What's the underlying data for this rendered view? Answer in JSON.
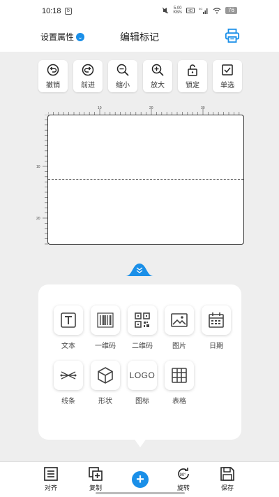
{
  "status_bar": {
    "time": "10:18",
    "speed_value": "5.00",
    "speed_unit": "KB/s",
    "battery": "76"
  },
  "header": {
    "set_attr_label": "设置属性",
    "title": "编辑标记"
  },
  "toolbar": [
    {
      "label": "撤销",
      "icon": "undo-icon"
    },
    {
      "label": "前进",
      "icon": "redo-icon"
    },
    {
      "label": "缩小",
      "icon": "zoom-out-icon"
    },
    {
      "label": "放大",
      "icon": "zoom-in-icon"
    },
    {
      "label": "锁定",
      "icon": "lock-icon"
    },
    {
      "label": "单选",
      "icon": "checkbox-icon"
    }
  ],
  "ruler": {
    "top_labels": [
      "10",
      "20",
      "30"
    ],
    "left_labels": [
      "10",
      "20"
    ]
  },
  "elements": [
    {
      "label": "文本",
      "icon": "text-icon"
    },
    {
      "label": "一维码",
      "icon": "barcode-icon"
    },
    {
      "label": "二维码",
      "icon": "qrcode-icon"
    },
    {
      "label": "图片",
      "icon": "image-icon"
    },
    {
      "label": "日期",
      "icon": "calendar-icon"
    },
    {
      "label": "线条",
      "icon": "line-icon"
    },
    {
      "label": "形状",
      "icon": "shape-icon"
    },
    {
      "label": "图标",
      "icon": "logo-icon",
      "tile_text": "LOGO"
    },
    {
      "label": "表格",
      "icon": "table-icon"
    }
  ],
  "bottom_bar": [
    {
      "label": "对齐",
      "icon": "align-icon"
    },
    {
      "label": "复制",
      "icon": "copy-icon"
    },
    {
      "label": "",
      "icon": "add-icon"
    },
    {
      "label": "旋转",
      "icon": "rotate-icon",
      "badge": "90°"
    },
    {
      "label": "保存",
      "icon": "save-icon"
    }
  ],
  "colors": {
    "accent": "#1a8fe8",
    "background": "#eeeeee"
  }
}
